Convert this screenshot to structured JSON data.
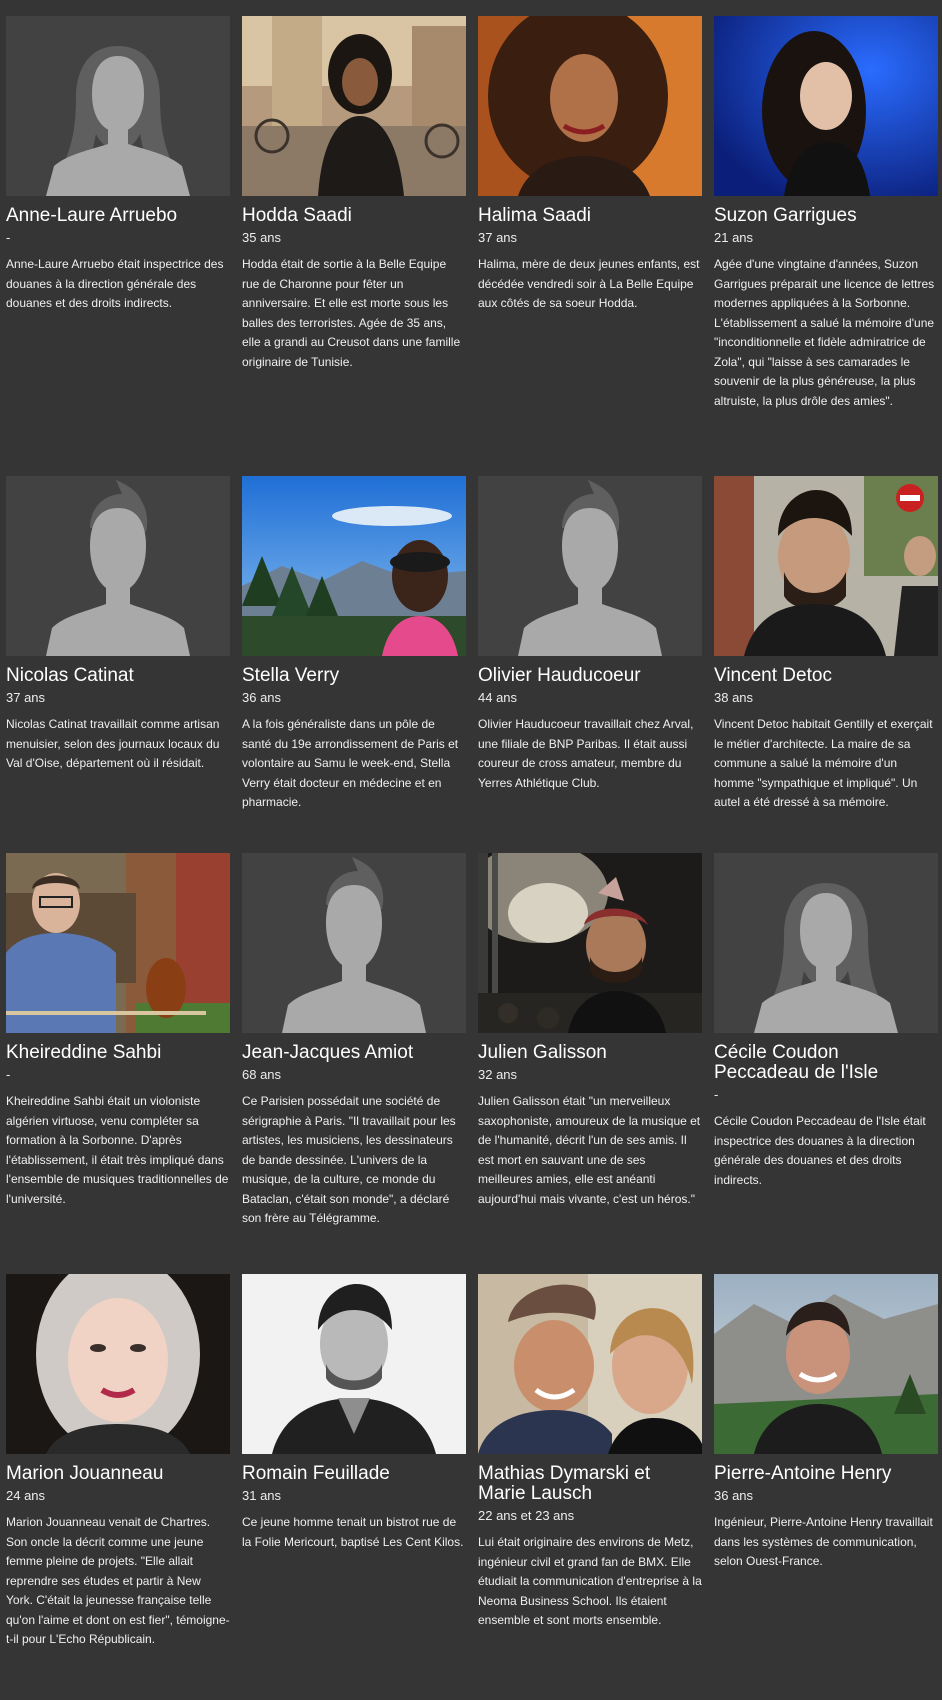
{
  "victims": [
    {
      "name": "Anne-Laure Arruebo",
      "age": "-",
      "photo_type": "placeholder-woman",
      "bio": "Anne-Laure Arruebo était inspectrice des douanes à la direction générale des douanes et des droits indirects."
    },
    {
      "name": "Hodda Saadi",
      "age": "35 ans",
      "photo_type": "photo",
      "bio": "Hodda était de sortie à la Belle Equipe rue de Charonne pour fêter un anniversaire. Et elle est morte sous les balles des terroristes. Agée de 35 ans, elle a grandi au Creusot dans une famille originaire de Tunisie."
    },
    {
      "name": "Halima Saadi",
      "age": "37 ans",
      "photo_type": "photo",
      "bio": "Halima, mère de deux jeunes enfants, est décédée vendredi soir à La Belle Equipe aux côtés de sa soeur Hodda."
    },
    {
      "name": "Suzon Garrigues",
      "age": "21 ans",
      "photo_type": "photo",
      "bio": "Agée d'une vingtaine d'années, Suzon Garrigues préparait une licence de lettres modernes appliquées à la Sorbonne. L'établissement a salué la mémoire d'une \"inconditionnelle et fidèle admiratrice de Zola\", qui \"laisse à ses camarades le souvenir de la plus généreuse, la plus altruiste, la plus drôle des amies\"."
    },
    {
      "name": "Nicolas Catinat",
      "age": "37 ans",
      "photo_type": "placeholder-man",
      "bio": "Nicolas Catinat travaillait comme artisan menuisier, selon des journaux locaux du Val d'Oise, département où il résidait."
    },
    {
      "name": "Stella Verry",
      "age": "36 ans",
      "photo_type": "photo",
      "bio": "A la fois généraliste dans un pôle de santé du 19e arrondissement de Paris et volontaire au Samu le week-end, Stella Verry était docteur en médecine et en pharmacie."
    },
    {
      "name": "Olivier Hauducoeur",
      "age": "44 ans",
      "photo_type": "placeholder-man",
      "bio": "Olivier Hauducoeur travaillait chez Arval, une filiale de BNP Paribas. Il était aussi coureur de cross amateur, membre du Yerres Athlétique Club."
    },
    {
      "name": "Vincent Detoc",
      "age": "38 ans",
      "photo_type": "photo",
      "bio": "Vincent Detoc habitait Gentilly et exerçait le métier d'architecte. La maire de sa commune a salué la mémoire d'un homme \"sympathique et impliqué\". Un autel a été dressé à sa mémoire."
    },
    {
      "name": "Kheireddine Sahbi",
      "age": "-",
      "photo_type": "photo",
      "bio": "Kheireddine Sahbi était un violoniste algérien virtuose, venu compléter sa formation à la Sorbonne. D'après l'établissement, il était très impliqué dans l'ensemble de musiques traditionnelles de l'université."
    },
    {
      "name": "Jean-Jacques Amiot",
      "age": "68 ans",
      "photo_type": "placeholder-man",
      "bio": "Ce Parisien possédait une société de sérigraphie à Paris. \"Il travaillait pour les artistes, les musiciens, les dessinateurs de bande dessinée. L'univers de la musique, de la culture, ce monde du Bataclan, c'était son monde\", a déclaré son frère au Télégramme."
    },
    {
      "name": "Julien Galisson",
      "age": "32 ans",
      "photo_type": "photo",
      "bio": "Julien Galisson était \"un merveilleux saxophoniste, amoureux de la musique et de l'humanité, décrit l'un de ses amis. Il est mort en sauvant une de ses meilleures amies, elle est anéanti aujourd'hui mais vivante, c'est un héros.\""
    },
    {
      "name": "Cécile Coudon Peccadeau de l'Isle",
      "age": "-",
      "photo_type": "placeholder-woman",
      "bio": "Cécile Coudon Peccadeau de l'Isle était inspectrice des douanes à la direction générale des douanes et des droits indirects."
    },
    {
      "name": "Marion Jouanneau",
      "age": "24 ans",
      "photo_type": "photo",
      "bio": "Marion Jouanneau venait de Chartres. Son oncle la décrit comme une jeune femme pleine de projets. \"Elle allait reprendre ses études et partir à New York. C'était la jeunesse française telle qu'on l'aime et dont on est fier\", témoigne-t-il pour L'Echo Républicain."
    },
    {
      "name": "Romain Feuillade",
      "age": "31 ans",
      "photo_type": "photo",
      "bio": "Ce jeune homme tenait un bistrot rue de la Folie Mericourt, baptisé Les Cent Kilos."
    },
    {
      "name": "Mathias Dymarski et Marie Lausch",
      "age": "22 ans et 23 ans",
      "photo_type": "photo",
      "bio": "Lui était originaire des environs de Metz, ingénieur civil et grand fan de BMX. Elle étudiait la communication d'entreprise à la Neoma Business School. Ils étaient ensemble et sont morts ensemble."
    },
    {
      "name": "Pierre-Antoine Henry",
      "age": "36 ans",
      "photo_type": "photo",
      "bio": "Ingénieur, Pierre-Antoine Henry travaillait dans les systèmes de communication, selon Ouest-France."
    }
  ]
}
